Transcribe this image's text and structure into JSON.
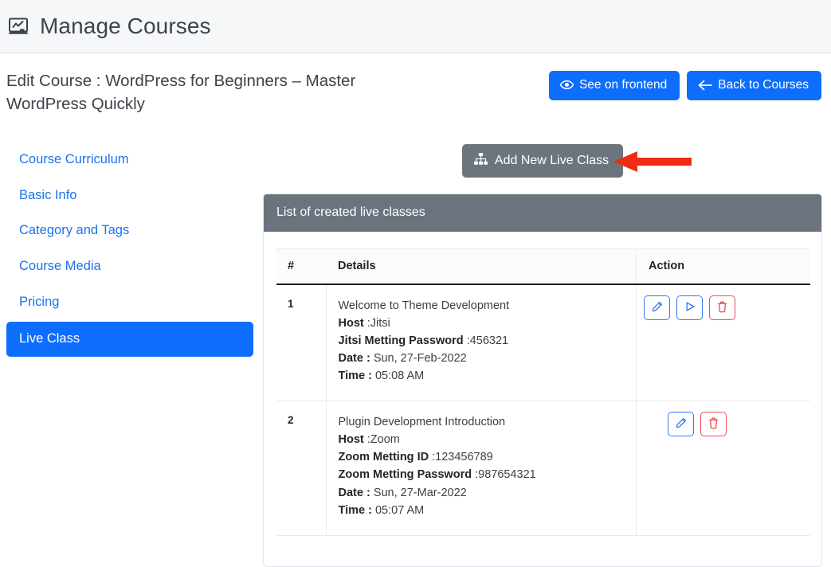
{
  "header": {
    "icon": "chart-board-icon",
    "title": "Manage Courses"
  },
  "course": {
    "title": "Edit Course : WordPress for Beginners – Master WordPress Quickly",
    "buttons": [
      {
        "label": "See on frontend",
        "icon": "eye-icon",
        "color": "#0d6efd"
      },
      {
        "label": "Back to Courses",
        "icon": "arrow-left-icon",
        "color": "#0d6efd"
      }
    ]
  },
  "sidebar": {
    "items": [
      {
        "label": "Course Curriculum",
        "active": false
      },
      {
        "label": "Basic Info",
        "active": false
      },
      {
        "label": "Category and Tags",
        "active": false
      },
      {
        "label": "Course Media",
        "active": false
      },
      {
        "label": "Pricing",
        "active": false
      },
      {
        "label": "Live Class",
        "active": true
      }
    ]
  },
  "main": {
    "add_button": {
      "label": "Add New Live Class",
      "icon": "sitemap-icon",
      "color": "#6c757d"
    },
    "annotation": {
      "shape": "arrow-left",
      "color": "#f02b11"
    },
    "card_header": "List of created live classes",
    "table": {
      "columns": [
        "#",
        "Details",
        "Action"
      ],
      "rows": [
        {
          "num": "1",
          "title": "Welcome to Theme Development",
          "fields": [
            {
              "label": "Host",
              "value": ":Jitsi"
            },
            {
              "label": "Jitsi Metting Password",
              "value": ":456321"
            },
            {
              "label": "Date :",
              "value": " Sun, 27-Feb-2022"
            },
            {
              "label": "Time :",
              "value": " 05:08 AM"
            }
          ],
          "actions": [
            {
              "name": "edit",
              "icon": "pencil-icon",
              "color": "#2f7bf6"
            },
            {
              "name": "start",
              "icon": "play-icon",
              "color": "#2f7bf6"
            },
            {
              "name": "delete",
              "icon": "trash-icon",
              "color": "#ef4a52"
            }
          ]
        },
        {
          "num": "2",
          "title": "Plugin Development Introduction",
          "fields": [
            {
              "label": "Host",
              "value": ":Zoom"
            },
            {
              "label": "Zoom Metting ID",
              "value": ":123456789"
            },
            {
              "label": "Zoom Metting Password",
              "value": ":987654321"
            },
            {
              "label": "Date :",
              "value": " Sun, 27-Mar-2022"
            },
            {
              "label": "Time :",
              "value": " 05:07 AM"
            }
          ],
          "actions": [
            {
              "name": "edit",
              "icon": "pencil-icon",
              "color": "#2f7bf6"
            },
            {
              "name": "delete",
              "icon": "trash-icon",
              "color": "#ef4a52"
            }
          ]
        }
      ]
    }
  }
}
